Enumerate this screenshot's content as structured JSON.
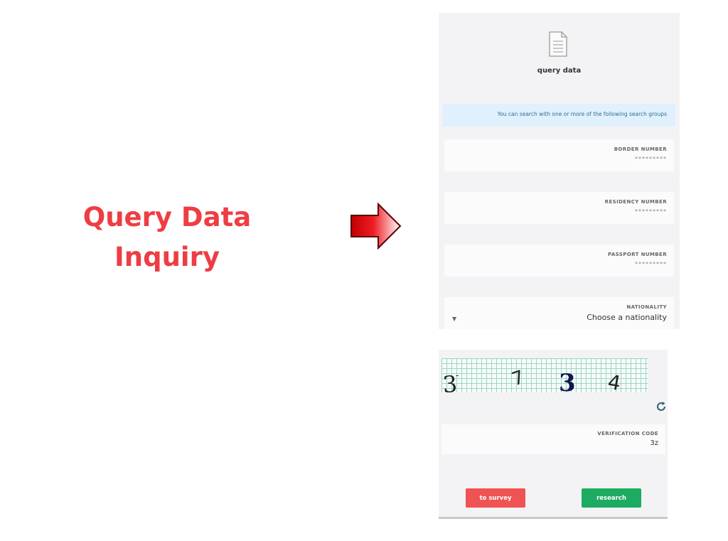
{
  "headline": {
    "line1": "Query Data",
    "line2": "Inquiry"
  },
  "panel": {
    "title": "query data",
    "info_text": "You can search with one or more of the following search groups",
    "fields": [
      {
        "label": "BORDER NUMBER",
        "placeholder": "*********"
      },
      {
        "label": "RESIDENCY NUMBER",
        "placeholder": "*********"
      },
      {
        "label": "PASSPORT NUMBER",
        "placeholder": "*********"
      }
    ],
    "nationality": {
      "label": "NATIONALITY",
      "value": "Choose a nationality"
    }
  },
  "captcha": {
    "text": "3 7 3 4"
  },
  "verification": {
    "label": "VERIFICATION CODE",
    "value": "3z"
  },
  "buttons": {
    "survey": "to survey",
    "research": "research"
  },
  "colors": {
    "headline": "#ee3d43",
    "survey_button": "#ef5353",
    "research_button": "#1dab61",
    "info_bg": "#e0f0fc"
  },
  "icons": [
    "right-arrow-icon",
    "document-icon",
    "chevron-down-icon",
    "refresh-icon"
  ]
}
